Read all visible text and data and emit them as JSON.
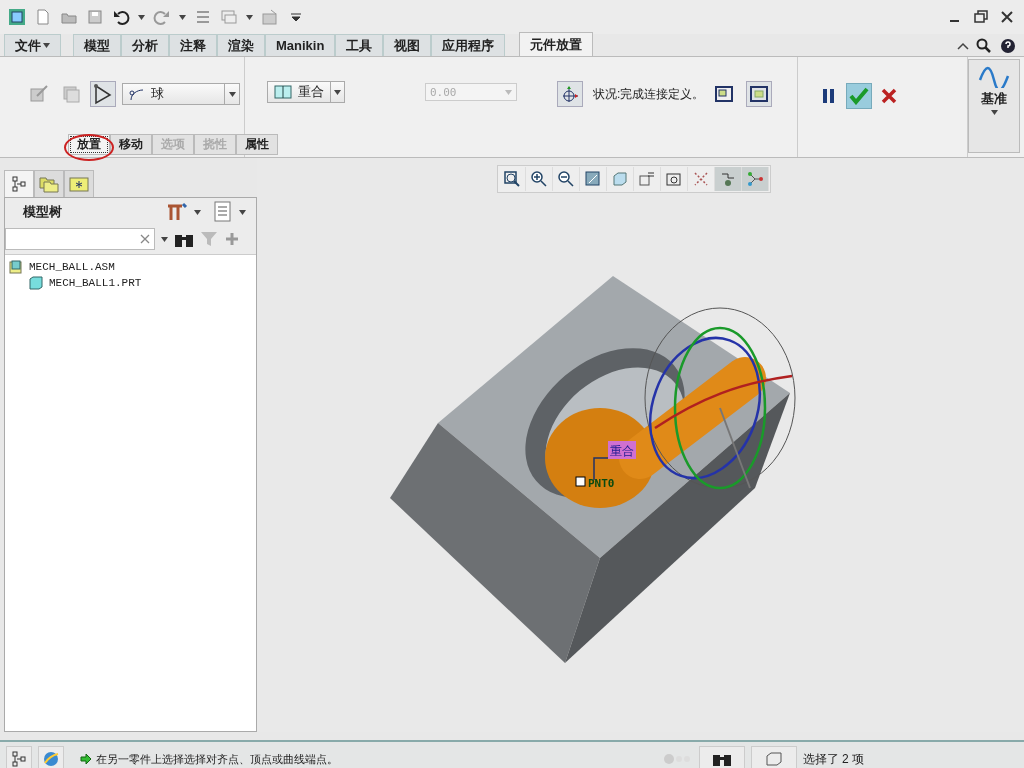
{
  "ribbon": {
    "tabs": [
      {
        "label": "文件",
        "selected": false,
        "kind": "menu"
      },
      {
        "label": "模型",
        "selected": false,
        "kind": "tab"
      },
      {
        "label": "分析",
        "selected": false,
        "kind": "tab"
      },
      {
        "label": "注释",
        "selected": false,
        "kind": "tab"
      },
      {
        "label": "渲染",
        "selected": false,
        "kind": "tab"
      },
      {
        "label": "Manikin",
        "selected": false,
        "kind": "tab"
      },
      {
        "label": "工具",
        "selected": false,
        "kind": "tab"
      },
      {
        "label": "视图",
        "selected": false,
        "kind": "tab"
      },
      {
        "label": "应用程序",
        "selected": false,
        "kind": "tab"
      },
      {
        "label": "元件放置",
        "selected": true,
        "kind": "tab"
      }
    ],
    "connection_type": "球",
    "constraint": "重合",
    "offset": {
      "value": "0.00",
      "disabled": true
    },
    "status": "状况:完成连接定义。",
    "datum": "基准",
    "subtabs": [
      {
        "label": "放置",
        "selected": true,
        "disabled": false
      },
      {
        "label": "移动",
        "selected": false,
        "disabled": false
      },
      {
        "label": "选项",
        "selected": false,
        "disabled": true
      },
      {
        "label": "挠性",
        "selected": false,
        "disabled": true
      },
      {
        "label": "属性",
        "selected": false,
        "disabled": false
      }
    ]
  },
  "navigator": {
    "tabs": [
      {
        "selected": true
      },
      {
        "selected": false
      },
      {
        "selected": false
      }
    ],
    "title": "模型树",
    "tree": [
      {
        "label": "MECH_BALL.ASM",
        "children": [
          {
            "label": "MECH_BALL1.PRT"
          }
        ]
      }
    ]
  },
  "view_toolbar": [
    {
      "on": false
    },
    {
      "on": false
    },
    {
      "on": false
    },
    {
      "on": false
    },
    {
      "on": false
    },
    {
      "on": false
    },
    {
      "on": false
    },
    {
      "on": false
    },
    {
      "on": true
    },
    {
      "on": true
    }
  ],
  "graphics": {
    "constraint_tag": "重合",
    "point_label": "PNT0"
  },
  "status_bar": {
    "message": "在另一零件上选择选择对齐点、顶点或曲线端点。",
    "selection": "选择了 2 项"
  }
}
